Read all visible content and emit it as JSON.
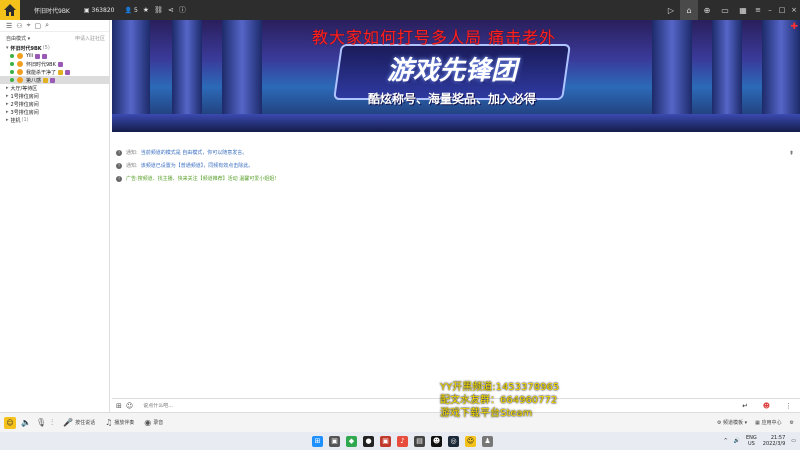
{
  "topbar": {
    "channel_name": "怀旧时代9BK",
    "channel_id": "363820",
    "user_count": "5",
    "right_icons": [
      "video-icon",
      "home-icon",
      "gamepad-icon",
      "window-icon",
      "grid-icon"
    ]
  },
  "sidebar": {
    "mode_label": "自由模式",
    "permission_label": "申请入驻社区",
    "root_channel": "怀旧时代9BK",
    "root_count": "(5)",
    "members": [
      {
        "name": "Yili"
      },
      {
        "name": "怀旧时代9BK"
      },
      {
        "name": "我能杀干净了"
      },
      {
        "name": "第八感"
      }
    ],
    "subchannels": [
      {
        "name": "大厅/等待区"
      },
      {
        "name": "1号排位房间"
      },
      {
        "name": "2号排位房间"
      },
      {
        "name": "3号排位房间"
      },
      {
        "name": "挂机",
        "count": "(1)"
      }
    ]
  },
  "banner": {
    "overlay_title": "教大家如何打号多人局    痛击老外",
    "logo_text": "游戏先锋团",
    "slogan": "酷炫称号、海量奖品、加入必得"
  },
  "messages": [
    {
      "label": "通知:",
      "text": "当前频道的模式是 自由模式，你可以随意发言。",
      "color": "blue"
    },
    {
      "label": "通知:",
      "text": "该频道已设置为【普通频道】，同频有效点击除此。",
      "color": "blue"
    },
    {
      "label": "",
      "text": "广告:搜频道、找主播、快来关注【频道推荐】活动 温馨可爱小姐姐!",
      "color": "green"
    }
  ],
  "input": {
    "placeholder": "说点什么吧..."
  },
  "bottombar": {
    "mic_label": "按住说话",
    "music_label": "播放伴奏",
    "record_label": "录音",
    "right_a": "频道模板",
    "right_b": "应用中心"
  },
  "ad": {
    "line1": "YY开黑频道:1453378965",
    "line2": "配文水友群：664960772",
    "line3": "游戏下载平台Steam"
  },
  "taskbar": {
    "lang_top": "ENG",
    "lang_bottom": "US",
    "time": "21:57",
    "date": "2022/3/9"
  },
  "colors": {
    "accent": "#f4c21a",
    "topbar": "#2d2d2d",
    "overlay_red": "#ff2020",
    "ad_yellow": "#ffe400"
  }
}
